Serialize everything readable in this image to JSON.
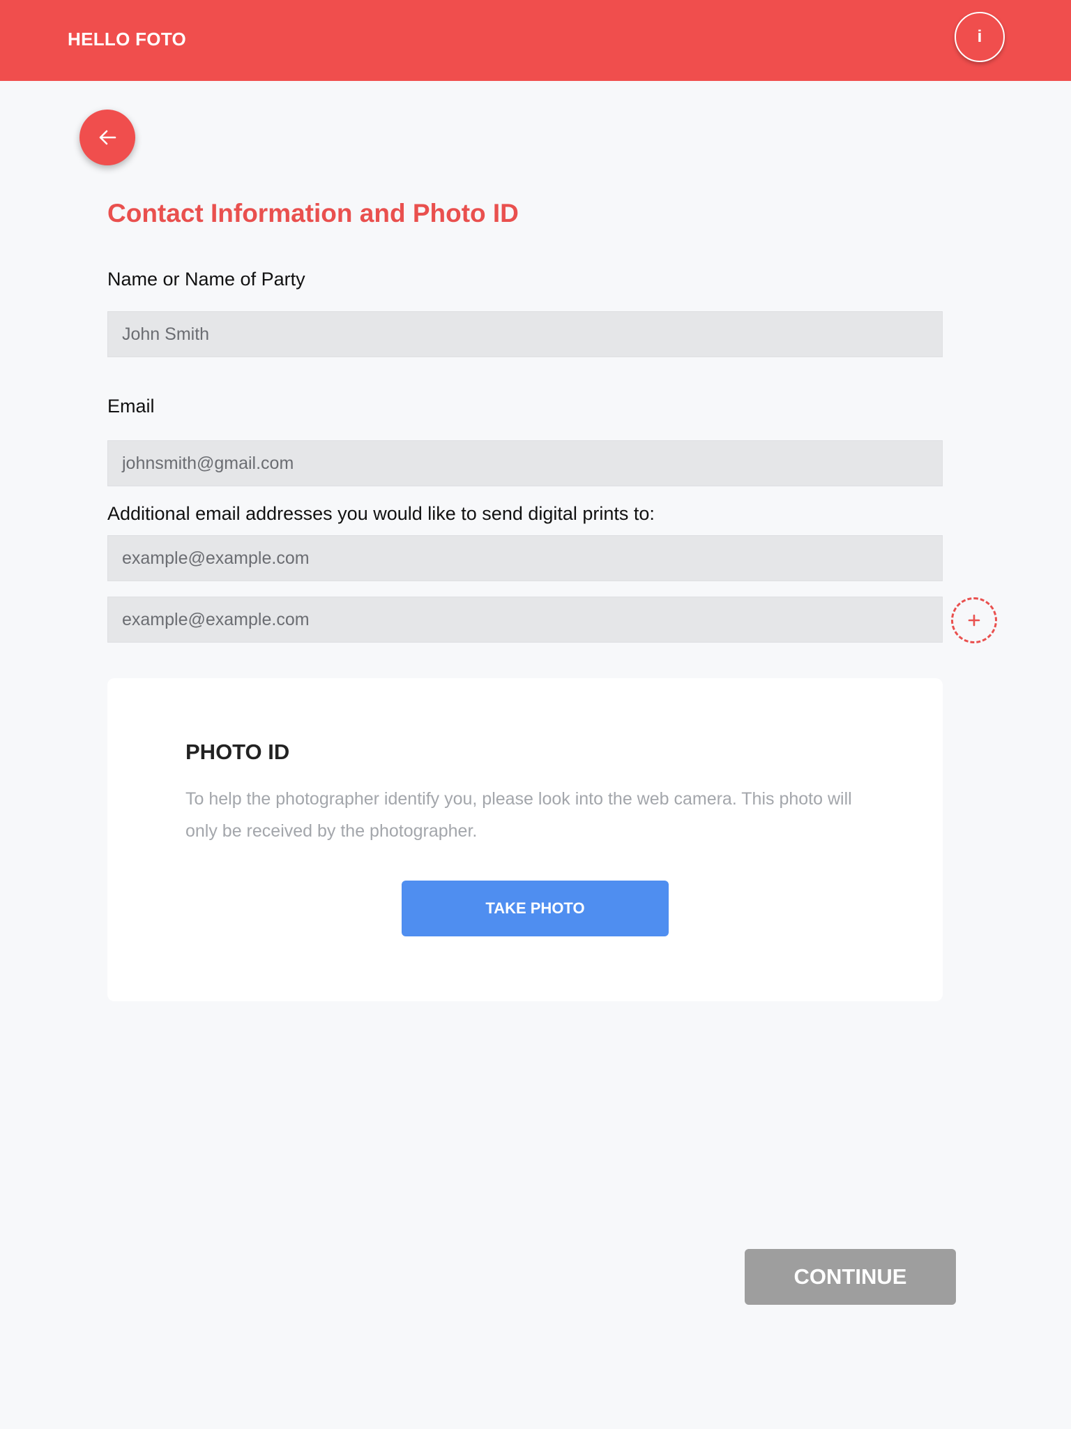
{
  "header": {
    "brand": "HELLO FOTO",
    "info_label": "i",
    "background_color": "#f04e4d"
  },
  "back_button": {
    "icon": "arrow-left-icon"
  },
  "page_title": "Contact Information and Photo ID",
  "form": {
    "name_label": "Name or Name of Party",
    "name_value": "John Smith",
    "email_label": "Email",
    "email_value": "johnsmith@gmail.com",
    "additional_label": "Additional email addresses you would like to send digital prints to:",
    "additional_emails": [
      {
        "placeholder": "example@example.com"
      },
      {
        "placeholder": "example@example.com"
      }
    ],
    "add_icon": "plus-icon"
  },
  "photo_id": {
    "title": "PHOTO ID",
    "description": "To help the photographer identify you, please look into the web camera. This photo will only be received by the photographer.",
    "button_label": "TAKE PHOTO",
    "button_color": "#4f8ef0"
  },
  "footer": {
    "continue_label": "CONTINUE",
    "continue_color": "#9e9e9e"
  }
}
